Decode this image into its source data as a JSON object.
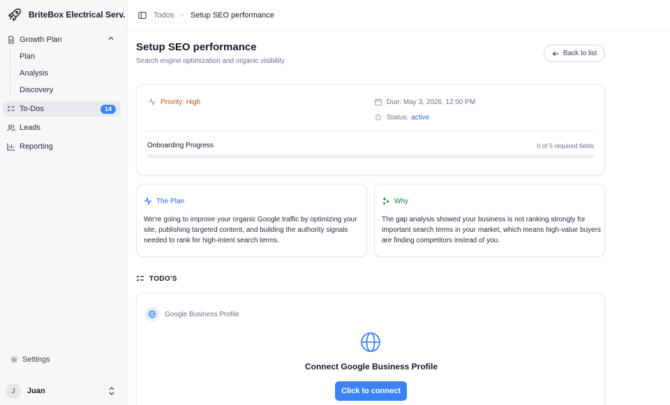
{
  "colors": {
    "accent": "#3b82f6",
    "priority": "#b45309",
    "status_active": "#2563eb",
    "plan_heading": "#2563eb",
    "why_heading": "#15803d"
  },
  "sidebar": {
    "brand": {
      "name": "BriteBox Electrical Serv...",
      "icon": "rocket-icon"
    },
    "growth_plan": {
      "label": "Growth Plan",
      "icon": "document-icon",
      "expanded": true,
      "children": [
        {
          "label": "Plan"
        },
        {
          "label": "Analysis"
        },
        {
          "label": "Discovery"
        }
      ]
    },
    "todos": {
      "label": "To-Dos",
      "icon": "checklist-icon",
      "badge": "14",
      "active": true
    },
    "leads": {
      "label": "Leads",
      "icon": "users-icon"
    },
    "reporting": {
      "label": "Reporting",
      "icon": "bar-chart-icon"
    },
    "settings": {
      "label": "Settings",
      "icon": "gear-icon"
    },
    "user": {
      "initial": "J",
      "name": "Juan"
    }
  },
  "topbar": {
    "breadcrumb": [
      {
        "label": "Todos"
      },
      {
        "label": "Setup SEO performance"
      }
    ]
  },
  "page": {
    "title": "Setup SEO performance",
    "subtitle": "Search engine optimization and organic visibility",
    "back_label": "Back to list"
  },
  "summary": {
    "priority": "Priority: High",
    "due": "Due: May 3, 2026, 12:00 PM",
    "status_label": "Status:",
    "status_value": "active",
    "progress_label": "Onboarding Progress",
    "progress_count": "0 of 5 required fields",
    "progress_fraction": 0
  },
  "plan": {
    "heading": "The Plan",
    "text": "We're going to improve your organic Google traffic by optimizing your site, publishing targeted content, and building the authority signals needed to rank for high-intent search terms."
  },
  "why": {
    "heading": "Why",
    "text": "The gap analysis showed your business is not ranking strongly for important search terms in your market, which means high-value buyers are finding competitors instead of you."
  },
  "todos": {
    "heading": "TODO'S",
    "item": {
      "tag": "Google Business Profile",
      "title": "Connect Google Business Profile",
      "button": "Click to connect"
    }
  }
}
